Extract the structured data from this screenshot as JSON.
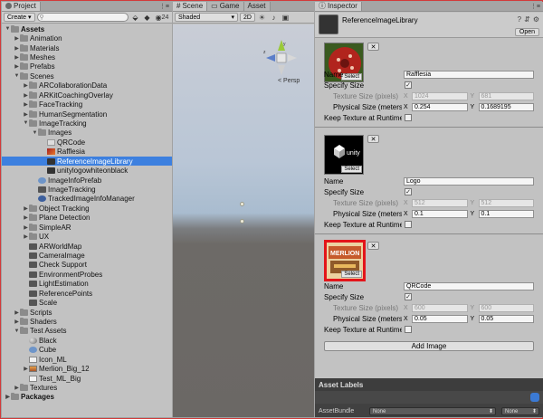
{
  "project": {
    "tab_label": "Project",
    "create_label": "Create",
    "search_placeholder": "",
    "badge": "24",
    "tree": [
      {
        "label": "Assets",
        "depth": 0,
        "kind": "folder",
        "expanded": true,
        "bold": true
      },
      {
        "label": "Animation",
        "depth": 1,
        "kind": "folder"
      },
      {
        "label": "Materials",
        "depth": 1,
        "kind": "folder"
      },
      {
        "label": "Meshes",
        "depth": 1,
        "kind": "folder"
      },
      {
        "label": "Prefabs",
        "depth": 1,
        "kind": "folder"
      },
      {
        "label": "Scenes",
        "depth": 1,
        "kind": "folder",
        "expanded": true
      },
      {
        "label": "ARCollaborationData",
        "depth": 2,
        "kind": "folder"
      },
      {
        "label": "ARKitCoachingOverlay",
        "depth": 2,
        "kind": "folder"
      },
      {
        "label": "FaceTracking",
        "depth": 2,
        "kind": "folder"
      },
      {
        "label": "HumanSegmentation",
        "depth": 2,
        "kind": "folder"
      },
      {
        "label": "ImageTracking",
        "depth": 2,
        "kind": "folder",
        "expanded": true
      },
      {
        "label": "Images",
        "depth": 3,
        "kind": "folder",
        "expanded": true
      },
      {
        "label": "QRCode",
        "depth": 4,
        "kind": "img",
        "leaf": true
      },
      {
        "label": "Rafflesia",
        "depth": 4,
        "kind": "rafflesia",
        "leaf": true
      },
      {
        "label": "ReferenceImageLibrary",
        "depth": 4,
        "kind": "lib",
        "leaf": true,
        "selected": true
      },
      {
        "label": "unitylogowhiteonblack",
        "depth": 4,
        "kind": "lib",
        "leaf": true
      },
      {
        "label": "ImageInfoPrefab",
        "depth": 3,
        "kind": "cube",
        "leaf": true
      },
      {
        "label": "ImageTracking",
        "depth": 3,
        "kind": "scene",
        "leaf": true
      },
      {
        "label": "TrackedImageInfoManager",
        "depth": 3,
        "kind": "cs",
        "leaf": true
      },
      {
        "label": "Object Tracking",
        "depth": 2,
        "kind": "folder"
      },
      {
        "label": "Plane Detection",
        "depth": 2,
        "kind": "folder"
      },
      {
        "label": "SimpleAR",
        "depth": 2,
        "kind": "folder"
      },
      {
        "label": "UX",
        "depth": 2,
        "kind": "folder"
      },
      {
        "label": "ARWorldMap",
        "depth": 2,
        "kind": "scene",
        "leaf": true
      },
      {
        "label": "CameraImage",
        "depth": 2,
        "kind": "scene",
        "leaf": true
      },
      {
        "label": "Check Support",
        "depth": 2,
        "kind": "scene",
        "leaf": true
      },
      {
        "label": "EnvironmentProbes",
        "depth": 2,
        "kind": "scene",
        "leaf": true
      },
      {
        "label": "LightEstimation",
        "depth": 2,
        "kind": "scene",
        "leaf": true
      },
      {
        "label": "ReferencePoints",
        "depth": 2,
        "kind": "scene",
        "leaf": true
      },
      {
        "label": "Scale",
        "depth": 2,
        "kind": "scene",
        "leaf": true
      },
      {
        "label": "Scripts",
        "depth": 1,
        "kind": "folder"
      },
      {
        "label": "Shaders",
        "depth": 1,
        "kind": "folder"
      },
      {
        "label": "Test Assets",
        "depth": 1,
        "kind": "folder",
        "expanded": true
      },
      {
        "label": "Black",
        "depth": 2,
        "kind": "mat",
        "leaf": true
      },
      {
        "label": "Cube",
        "depth": 2,
        "kind": "cube",
        "leaf": true
      },
      {
        "label": "Icon_ML",
        "depth": 2,
        "kind": "tex",
        "leaf": true
      },
      {
        "label": "Merlion_Big_12",
        "depth": 2,
        "kind": "merlion"
      },
      {
        "label": "Test_ML_Big",
        "depth": 2,
        "kind": "tex",
        "leaf": true
      },
      {
        "label": "Textures",
        "depth": 1,
        "kind": "folder"
      },
      {
        "label": "Packages",
        "depth": 0,
        "kind": "folder",
        "bold": true
      }
    ]
  },
  "scene": {
    "tabs": [
      "Scene",
      "Game",
      "Asset"
    ],
    "shading_mode": "Shaded",
    "mode_2d": "2D",
    "persp_label": "< Persp"
  },
  "inspector": {
    "tab_label": "Inspector",
    "asset_title": "ReferenceImageLibrary",
    "open_label": "Open",
    "select_label": "Select",
    "remove_label": "✕",
    "labels": {
      "name": "Name",
      "specify_size": "Specify Size",
      "texture_size": "Texture Size (pixels)",
      "physical_size": "Physical Size (meters)",
      "keep_texture": "Keep Texture at Runtime"
    },
    "entries": [
      {
        "name": "Rafflesia",
        "specify_size": true,
        "tex_x": "1024",
        "tex_y": "681",
        "phys_x": "0.254",
        "phys_y": "0.1689195",
        "keep": false
      },
      {
        "name": "Logo",
        "specify_size": true,
        "tex_x": "512",
        "tex_y": "512",
        "phys_x": "0.1",
        "phys_y": "0.1",
        "keep": false
      },
      {
        "name": "QRCode",
        "specify_size": true,
        "tex_x": "600",
        "tex_y": "600",
        "phys_x": "0.05",
        "phys_y": "0.05",
        "keep": false
      }
    ],
    "add_image_label": "Add Image",
    "asset_labels_title": "Asset Labels",
    "asset_bundle_label": "AssetBundle",
    "bundle_value": "None",
    "variant_value": "None"
  },
  "colors": {
    "selection": "#3d80df",
    "highlight_border": "#e3151a"
  }
}
